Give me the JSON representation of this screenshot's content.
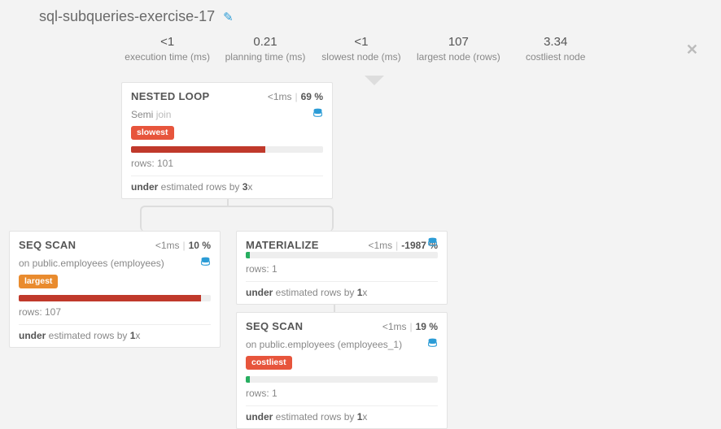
{
  "title": "sql-subqueries-exercise-17",
  "stats": [
    {
      "value": "<1",
      "label": "execution time (ms)"
    },
    {
      "value": "0.21",
      "label": "planning time (ms)"
    },
    {
      "value": "<1",
      "label": "slowest node (ms)"
    },
    {
      "value": "107",
      "label": "largest node (rows)"
    },
    {
      "value": "3.34",
      "label": "costliest node"
    }
  ],
  "nodes": {
    "root": {
      "title": "NESTED LOOP",
      "time": "<1ms",
      "pct": "69",
      "sub_left": "Semi",
      "sub_join": "join",
      "badge": "slowest",
      "bar_width": "70%",
      "bar_color": "bar-red",
      "rows": "rows: 101",
      "est_prefix": "under",
      "est_mid": " estimated rows by ",
      "est_factor": "3",
      "est_suffix": "x"
    },
    "seq1": {
      "title": "SEQ SCAN",
      "time": "<1ms",
      "pct": "10",
      "sub_left": "on public.employees (employees)",
      "badge": "largest",
      "bar_width": "95%",
      "bar_color": "bar-red",
      "rows": "rows: 107",
      "est_prefix": "under",
      "est_mid": " estimated rows by ",
      "est_factor": "1",
      "est_suffix": "x"
    },
    "mat": {
      "title": "MATERIALIZE",
      "time": "<1ms",
      "pct": "-1987",
      "bar_width": "2%",
      "bar_color": "bar-green",
      "rows": "rows: 1",
      "est_prefix": "under",
      "est_mid": " estimated rows by ",
      "est_factor": "1",
      "est_suffix": "x"
    },
    "seq2": {
      "title": "SEQ SCAN",
      "time": "<1ms",
      "pct": "19",
      "sub_left": "on public.employees (employees_1)",
      "badge": "costliest",
      "bar_width": "2%",
      "bar_color": "bar-green",
      "rows": "rows: 1",
      "est_prefix": "under",
      "est_mid": " estimated rows by ",
      "est_factor": "1",
      "est_suffix": "x"
    }
  }
}
